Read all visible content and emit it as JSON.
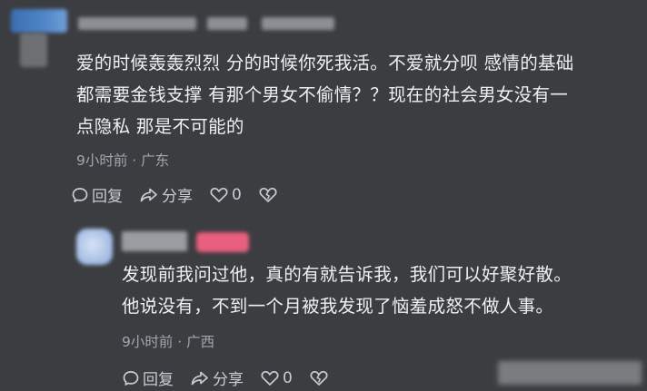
{
  "comment1": {
    "lines": [
      "爱的时候轰轰烈烈 分的时候你死我活。不爱就分呗 感情的基础",
      "都需要金钱支撑 有那个男女不偷情？？现在的社会男女没有一",
      "点隐私 那是不可能的"
    ],
    "meta": "9小时前 · 广东",
    "reply_label": "回复",
    "share_label": "分享",
    "like_count": "0"
  },
  "comment2": {
    "lines": [
      "发现前我问过他，真的有就告诉我，我们可以好聚好散。",
      "他说没有，不到一个月被我发现了恼羞成怒不做人事。"
    ],
    "meta": "9小时前 · 广西",
    "reply_label": "回复",
    "share_label": "分享",
    "like_count": "0"
  },
  "colors": {
    "background": "#3c3d41",
    "text": "#eef0f4",
    "meta": "#a3a6ad",
    "badge": "#e8607e"
  },
  "icons": [
    "reply-bubble-icon",
    "share-arrow-icon",
    "heart-icon",
    "broken-heart-icon"
  ]
}
